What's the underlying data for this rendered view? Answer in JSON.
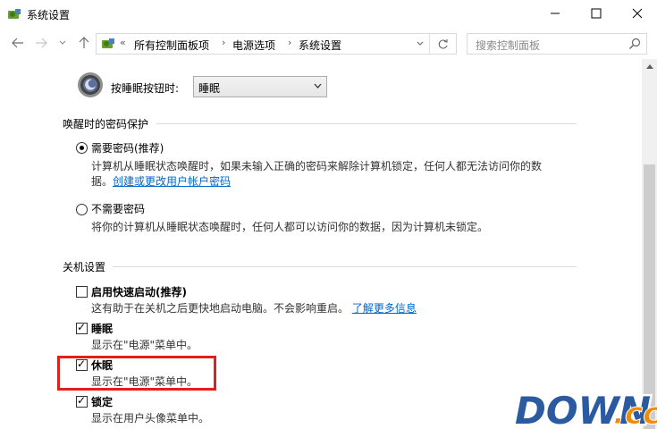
{
  "window": {
    "title": "系统设置",
    "minimize_glyph": "—",
    "maximize_glyph": "☐",
    "close_glyph": "✕"
  },
  "navigation": {
    "back_icon": "back-arrow-icon",
    "breadcrumb_overflow": "«",
    "breadcrumbs": [
      "所有控制面板项",
      "电源选项",
      "系统设置"
    ],
    "search_placeholder": "搜索控制面板"
  },
  "sleep_button": {
    "label": "按睡眠按钮时:",
    "selected": "睡眠"
  },
  "wake_password": {
    "heading": "唤醒时的密码保护",
    "options": [
      {
        "label": "需要密码(推荐)",
        "checked": true,
        "desc_line1": "计算机从睡眠状态唤醒时，如果未输入正确的密码来解除计算机锁定，任何人都无法访问你的数",
        "desc_line2_prefix": "据。",
        "link": "创建或更改用户帐户密码"
      },
      {
        "label": "不需要密码",
        "checked": false,
        "desc_line1": "将你的计算机从睡眠状态唤醒时，任何人都可以访问你的数据，因为计算机未锁定。"
      }
    ]
  },
  "shutdown": {
    "heading": "关机设置",
    "items": [
      {
        "label": "启用快速启动(推荐)",
        "checked": false,
        "desc": "这有助于在关机之后更快地启动电脑。不会影响重启。",
        "link": "了解更多信息"
      },
      {
        "label": "睡眠",
        "checked": true,
        "desc": "显示在\"电源\"菜单中。"
      },
      {
        "label": "休眠",
        "checked": true,
        "desc": "显示在\"电源\"菜单中。"
      },
      {
        "label": "锁定",
        "checked": true,
        "desc": "显示在用户头像菜单中。"
      }
    ]
  },
  "watermark": {
    "text": "DOWN",
    "suffix": ".cc"
  },
  "colors": {
    "link": "#0066cc",
    "highlight": "#e0201b",
    "watermark_blue": "#2c5aa0",
    "watermark_orange": "#f08c00"
  }
}
